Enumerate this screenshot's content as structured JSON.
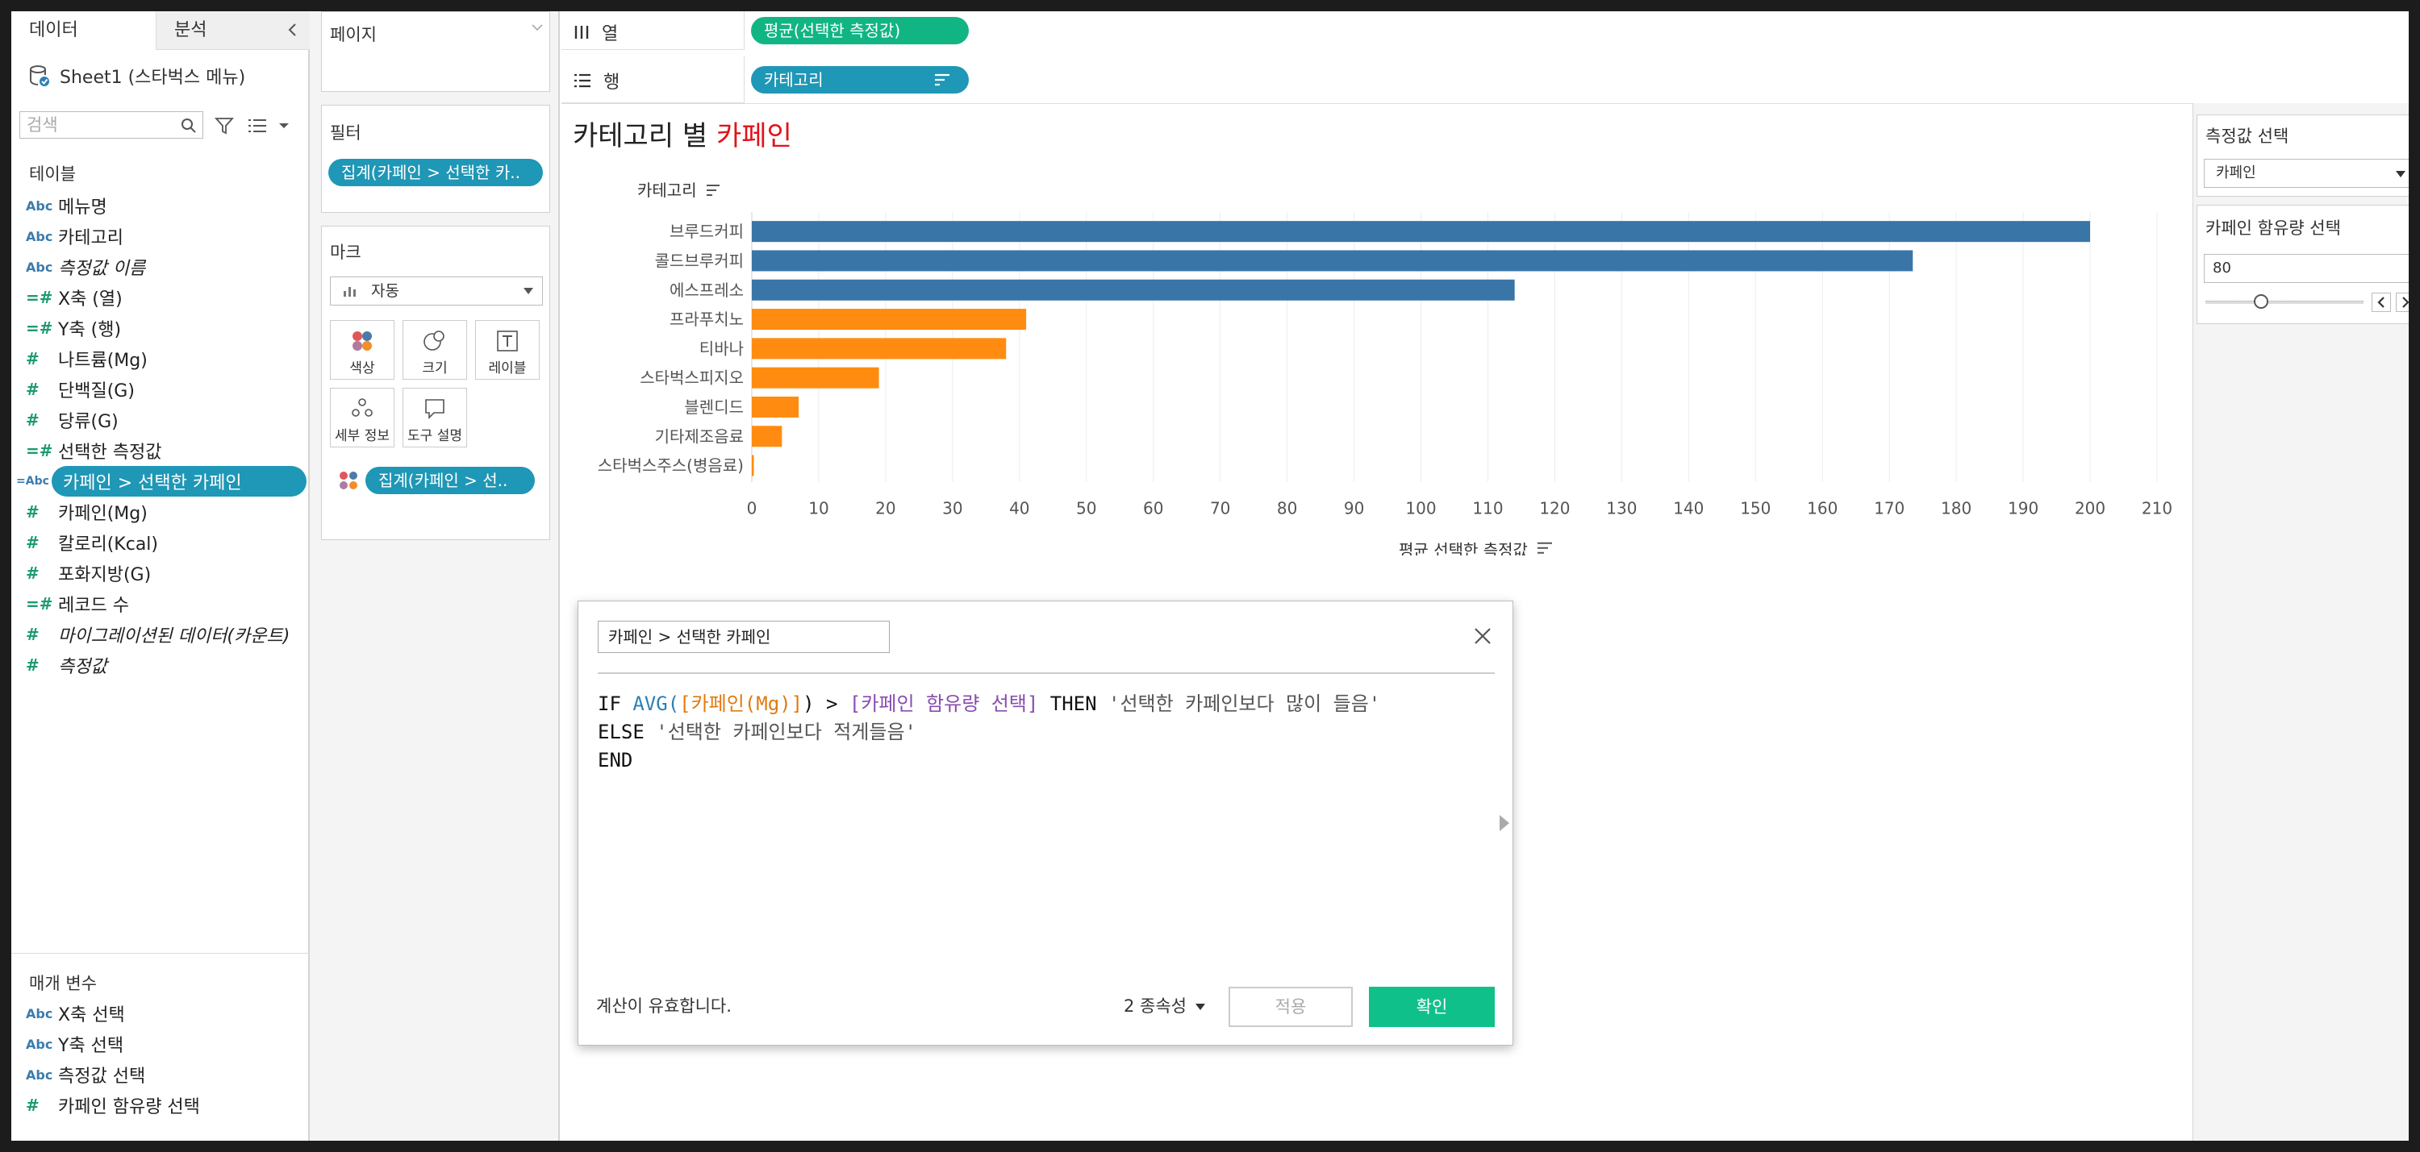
{
  "data_pane": {
    "tab_data": "데이터",
    "tab_analysis": "분석",
    "datasource": "Sheet1 (스타벅스 메뉴)",
    "search_placeholder": "검색",
    "tables_label": "테이블",
    "fields": [
      {
        "type": "Abc",
        "name": "메뉴명",
        "italic": false
      },
      {
        "type": "Abc",
        "name": "카테고리",
        "italic": false
      },
      {
        "type": "Abc",
        "name": "측정값 이름",
        "italic": true
      },
      {
        "type": "=#",
        "name": "X축 (열)",
        "italic": false
      },
      {
        "type": "=#",
        "name": "Y축 (행)",
        "italic": false
      },
      {
        "type": "#",
        "name": "나트륨(Mg)",
        "italic": false
      },
      {
        "type": "#",
        "name": "단백질(G)",
        "italic": false
      },
      {
        "type": "#",
        "name": "당류(G)",
        "italic": false
      },
      {
        "type": "=#",
        "name": "선택한 측정값",
        "italic": false
      },
      {
        "type": "=Abc",
        "name": "카페인 > 선택한 카페인",
        "italic": false,
        "selected": true
      },
      {
        "type": "#",
        "name": "카페인(Mg)",
        "italic": false
      },
      {
        "type": "#",
        "name": "칼로리(Kcal)",
        "italic": false
      },
      {
        "type": "#",
        "name": "포화지방(G)",
        "italic": false
      },
      {
        "type": "=#",
        "name": "레코드 수",
        "italic": false
      },
      {
        "type": "#",
        "name": "마이그레이션된 데이터(카운트)",
        "italic": true
      },
      {
        "type": "#",
        "name": "측정값",
        "italic": true
      }
    ],
    "params_label": "매개 변수",
    "params": [
      {
        "type": "Abc",
        "name": "X축 선택"
      },
      {
        "type": "Abc",
        "name": "Y축 선택"
      },
      {
        "type": "Abc",
        "name": "측정값 선택"
      },
      {
        "type": "#",
        "name": "카페인 함유량 선택"
      }
    ]
  },
  "cards": {
    "pages_label": "페이지",
    "filters_label": "필터",
    "filter_pill": "집계(카페인 > 선택한 카..",
    "marks_label": "마크",
    "mark_type": "자동",
    "mark_buttons": [
      "색상",
      "크기",
      "레이블",
      "세부 정보",
      "도구 설명"
    ],
    "color_pill": "집계(카페인 > 선..",
    "colors": {
      "teal": "#1f97b6",
      "green": "#11b583"
    }
  },
  "shelves": {
    "columns_label": "열",
    "columns_pill": "평균(선택한 측정값)",
    "rows_label": "행",
    "rows_pill": "카테고리"
  },
  "view": {
    "title_prefix": "카테고리 별 ",
    "title_accent": "카페인",
    "title_accent_color": "#e0131b"
  },
  "chart_data": {
    "type": "bar",
    "orientation": "horizontal",
    "row_header": "카테고리",
    "xlabel": "평균 선택한 측정값",
    "xlim": [
      0,
      210
    ],
    "x_ticks": [
      0,
      10,
      20,
      30,
      40,
      50,
      60,
      70,
      80,
      90,
      100,
      110,
      120,
      130,
      140,
      150,
      160,
      170,
      180,
      190,
      200,
      210
    ],
    "categories": [
      "브루드커피",
      "콜드브루커피",
      "에스프레소",
      "프라푸치노",
      "티바나",
      "스타벅스피지오",
      "블렌디드",
      "기타제조음료",
      "스타벅스주스(병음료)"
    ],
    "values": [
      200,
      173.5,
      114,
      41,
      38,
      19,
      7,
      4.5,
      0.3
    ],
    "groups": [
      "high",
      "high",
      "high",
      "low",
      "low",
      "low",
      "low",
      "low",
      "low"
    ],
    "group_colors": {
      "high": "#3a75a8",
      "low": "#ff8c10"
    },
    "grid": "vertical"
  },
  "parameters": {
    "measure_title": "측정값 선택",
    "measure_value": "카페인",
    "caffeine_title": "카페인 함유량 선택",
    "caffeine_value": "80",
    "slider_fraction": 0.35
  },
  "calc_dialog": {
    "name": "카페인 > 선택한 카페인",
    "line1": {
      "kw_if": "IF",
      "fn": "AVG(",
      "field": "[카페인(Mg)]",
      "close": ") > ",
      "param": "[카페인 함유량 선택]",
      "kw_then": " THEN ",
      "str": "'선택한 카페인보다 많이 들음'"
    },
    "line2": {
      "kw_else": "ELSE ",
      "str": "'선택한 카페인보다 적게들음'"
    },
    "line3": "END",
    "status": "계산이 유효합니다.",
    "dependencies": "2 종속성",
    "apply": "적용",
    "ok": "확인"
  }
}
